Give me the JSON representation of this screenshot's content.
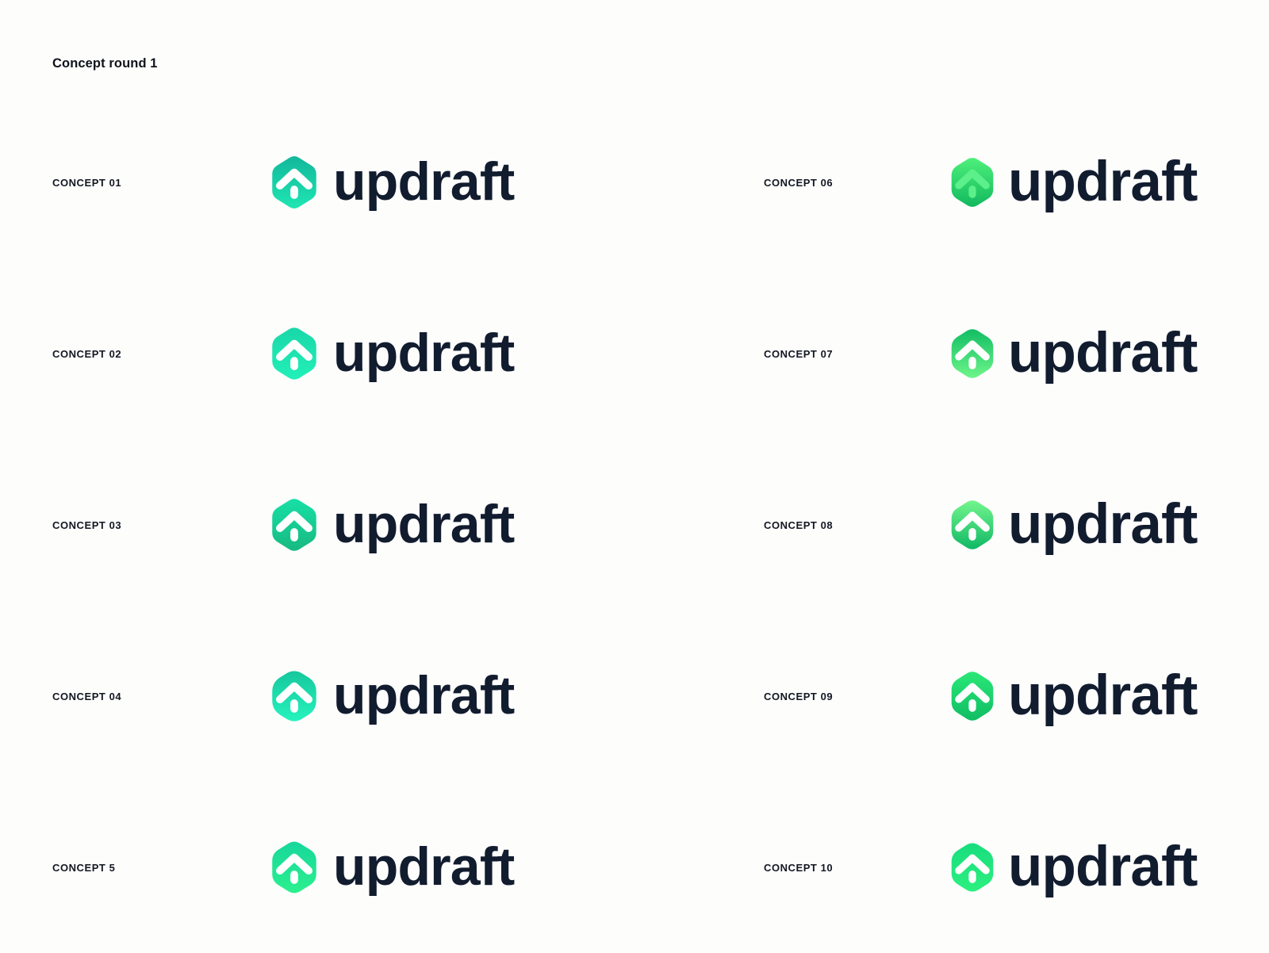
{
  "board": {
    "title": "Concept round 1",
    "background_color": "#fdfdfc",
    "wordmark": "updraft",
    "wordmark_color": "#121c2f",
    "label_color": "#131722"
  },
  "mark": {
    "shape": "rounded-hexagon",
    "glyph": "upward-chevron-with-dot",
    "chevron_name": "chevron-up-icon",
    "dot_name": "dot-indicator-icon"
  },
  "columns": [
    {
      "id": "left",
      "concepts": [
        {
          "label": "CONCEPT 01",
          "wordmark": "updraft",
          "mark": {
            "top_color": "#12b79b",
            "bottom_color": "#1fe6b2",
            "glyph_color": "#ffffff",
            "corner_radius": 10,
            "variant": "white-glyph"
          }
        },
        {
          "label": "CONCEPT 02",
          "wordmark": "updraft",
          "mark": {
            "top_color": "#1ad7a8",
            "bottom_color": "#22f0b8",
            "glyph_color": "#ffffff",
            "corner_radius": 12,
            "variant": "white-glyph"
          }
        },
        {
          "label": "CONCEPT 03",
          "wordmark": "updraft",
          "mark": {
            "top_color": "#17e0a6",
            "bottom_color": "#17b981",
            "glyph_color": "#ffffff",
            "corner_radius": 11,
            "variant": "white-glyph"
          }
        },
        {
          "label": "CONCEPT 04",
          "wordmark": "updraft",
          "mark": {
            "top_color": "#16c79d",
            "bottom_color": "#26f3bd",
            "glyph_color": "#ffffff",
            "corner_radius": 17,
            "variant": "white-glyph"
          }
        },
        {
          "label": "CONCEPT 5",
          "wordmark": "updraft",
          "mark": {
            "top_color": "#17d79b",
            "bottom_color": "#2bf08e",
            "glyph_color": "#ffffff",
            "corner_radius": 13,
            "variant": "white-glyph"
          }
        }
      ]
    },
    {
      "id": "right",
      "concepts": [
        {
          "label": "CONCEPT 06",
          "wordmark": "updraft",
          "mark": {
            "top_color": "#4ef07a",
            "bottom_color": "#12b95e",
            "glyph_color": "#5cf08a",
            "corner_radius": 12,
            "variant": "tonal-glyph"
          }
        },
        {
          "label": "CONCEPT 07",
          "wordmark": "updraft",
          "mark": {
            "top_color": "#12bd63",
            "bottom_color": "#6df58a",
            "glyph_color": "#ffffff",
            "corner_radius": 13,
            "variant": "white-glyph"
          }
        },
        {
          "label": "CONCEPT 08",
          "wordmark": "updraft",
          "mark": {
            "top_color": "#73f58d",
            "bottom_color": "#10b865",
            "glyph_color": "#ffffff",
            "corner_radius": 13,
            "variant": "white-glyph"
          }
        },
        {
          "label": "CONCEPT 09",
          "wordmark": "updraft",
          "mark": {
            "top_color": "#2ae877",
            "bottom_color": "#10bd63",
            "glyph_color": "#ffffff",
            "corner_radius": 13,
            "variant": "white-glyph"
          }
        },
        {
          "label": "CONCEPT 10",
          "wordmark": "updraft",
          "mark": {
            "top_color": "#18dd7d",
            "bottom_color": "#2cf07f",
            "glyph_color": "#ffffff",
            "corner_radius": 14,
            "variant": "white-glyph"
          }
        }
      ]
    }
  ]
}
